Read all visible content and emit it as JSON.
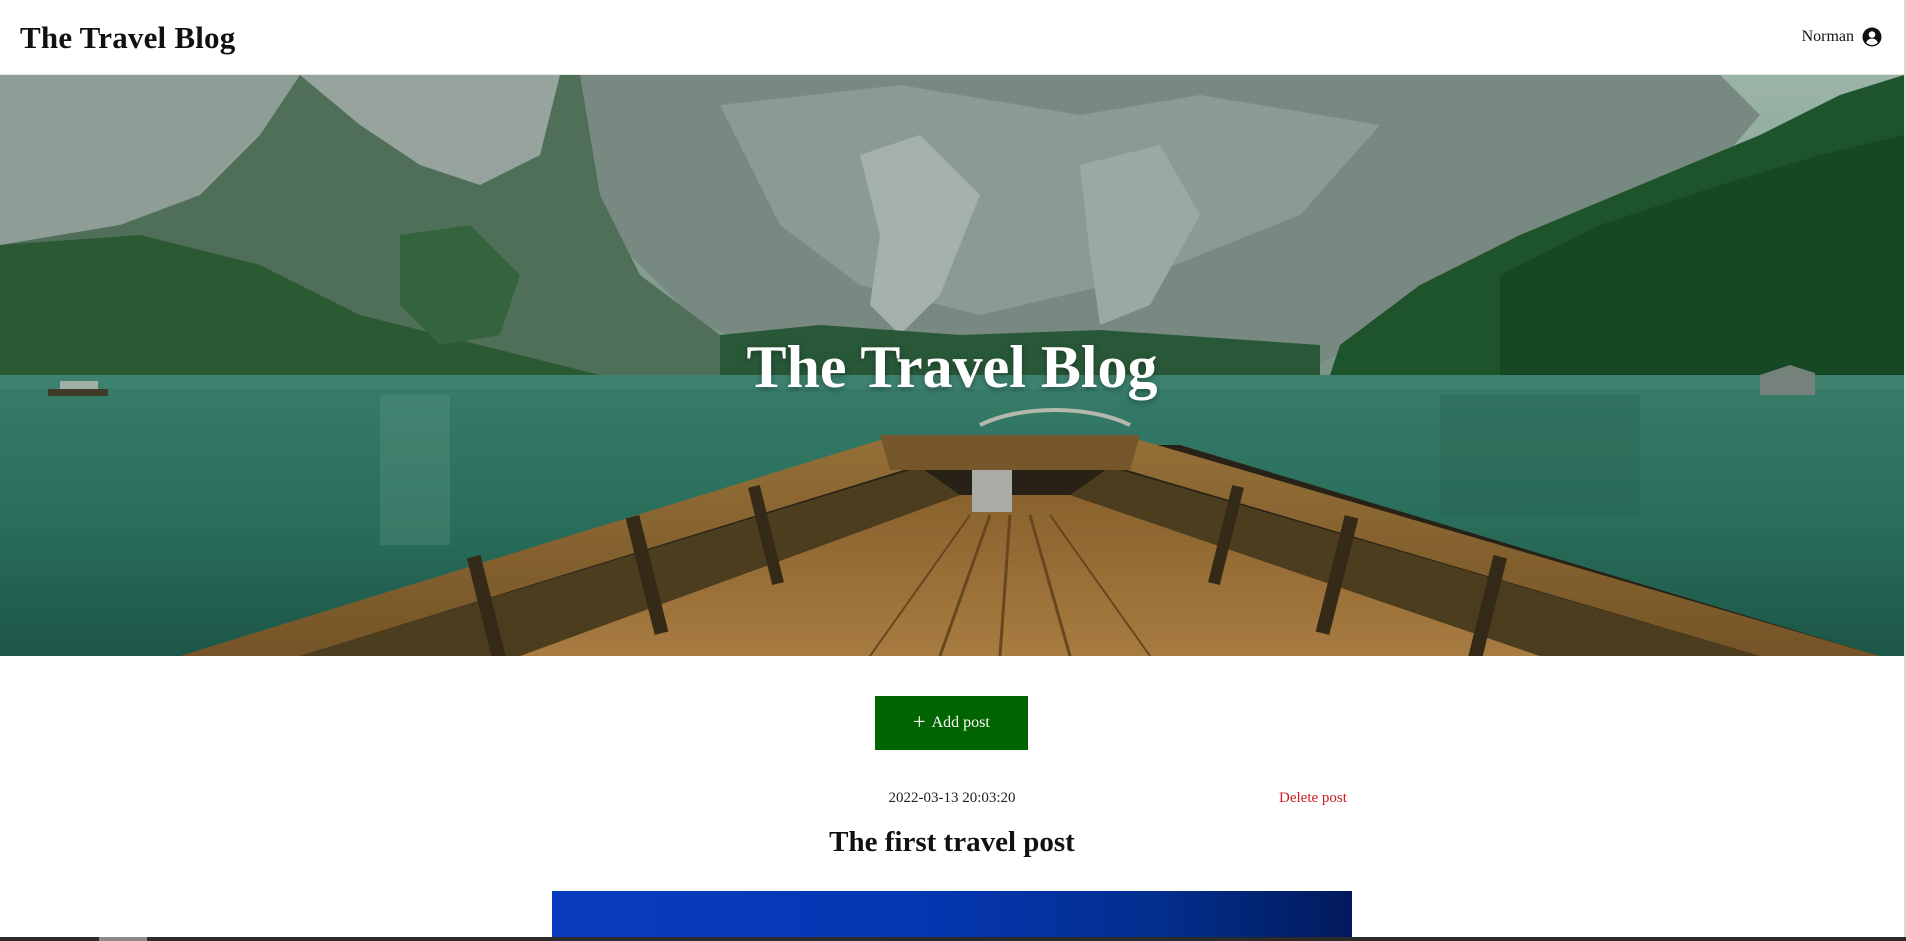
{
  "header": {
    "brand": "The Travel Blog",
    "user_name": "Norman",
    "user_icon": "user-circle-icon"
  },
  "hero": {
    "title": "The Travel Blog"
  },
  "actions": {
    "add_post_label": "Add post",
    "add_post_icon": "plus-icon"
  },
  "posts": [
    {
      "timestamp": "2022-03-13 20:03:20",
      "delete_label": "Delete post",
      "title": "The first travel post"
    }
  ],
  "colors": {
    "primary_button": "#006400",
    "delete_link": "#cc1f1f",
    "post_image_blue": "#0a3cbf"
  }
}
